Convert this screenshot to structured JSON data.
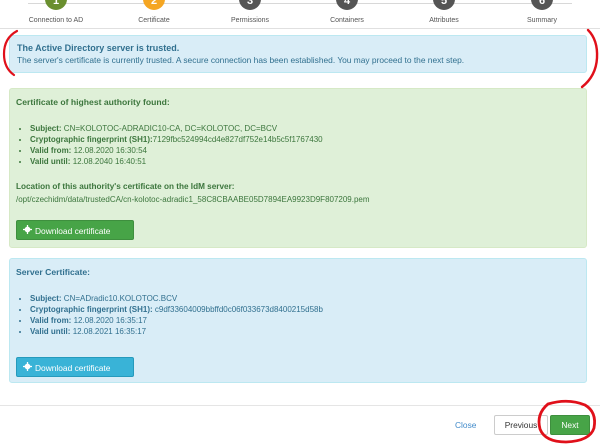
{
  "wizard": {
    "steps": [
      {
        "number": "1",
        "label": "Connection to AD",
        "color": "#6a8f2f"
      },
      {
        "number": "2",
        "label": "Certificate",
        "color": "#f5a623"
      },
      {
        "number": "3",
        "label": "Permissions",
        "color": "#555555"
      },
      {
        "number": "4",
        "label": "Containers",
        "color": "#555555"
      },
      {
        "number": "5",
        "label": "Attributes",
        "color": "#555555"
      },
      {
        "number": "6",
        "label": "Summary",
        "color": "#555555"
      }
    ]
  },
  "alert": {
    "title": "The Active Directory server is trusted.",
    "text": "The server's certificate is currently trusted. A secure connection has been established. You may proceed to the next step."
  },
  "authority_cert": {
    "title": "Certificate of highest authority found:",
    "subject_label": "Subject:",
    "subject": "CN=KOLOTOC-ADRADIC10-CA, DC=KOLOTOC, DC=BCV",
    "fingerprint_label": "Cryptographic fingerprint (SH1):",
    "fingerprint": "7129fbc524994cd4e827df752e14b5c5f1767430",
    "valid_from_label": "Valid from:",
    "valid_from": "12.08.2020 16:30:54",
    "valid_until_label": "Valid until:",
    "valid_until": "12.08.2040 16:40:51",
    "location_title": "Location of this authority's certificate on the IdM server:",
    "location_path": "/opt/czechidm/data/trustedCA/cn-kolotoc-adradic1_58C8CBAABE05D7894EA9923D9F807209.pem",
    "download_label": "Download certificate"
  },
  "server_cert": {
    "title": "Server Certificate:",
    "subject_label": "Subject:",
    "subject": "CN=ADradic10.KOLOTOC.BCV",
    "fingerprint_label": "Cryptographic fingerprint (SH1):",
    "fingerprint": "c9df33604009bbffd0c06f033673d8400215d58b",
    "valid_from_label": "Valid from:",
    "valid_from": "12.08.2020 16:35:17",
    "valid_until_label": "Valid until:",
    "valid_until": "12.08.2021 16:35:17",
    "download_label": "Download certificate"
  },
  "footer": {
    "close_label": "Close",
    "previous_label": "Previous",
    "next_label": "Next"
  },
  "colors": {
    "success_bg": "#dff0d8",
    "info_bg": "#d9edf7",
    "primary_green": "#47a447",
    "info_button": "#39b3d7",
    "annotation_red": "#e0101a"
  },
  "icons": [
    "certificate-icon"
  ]
}
